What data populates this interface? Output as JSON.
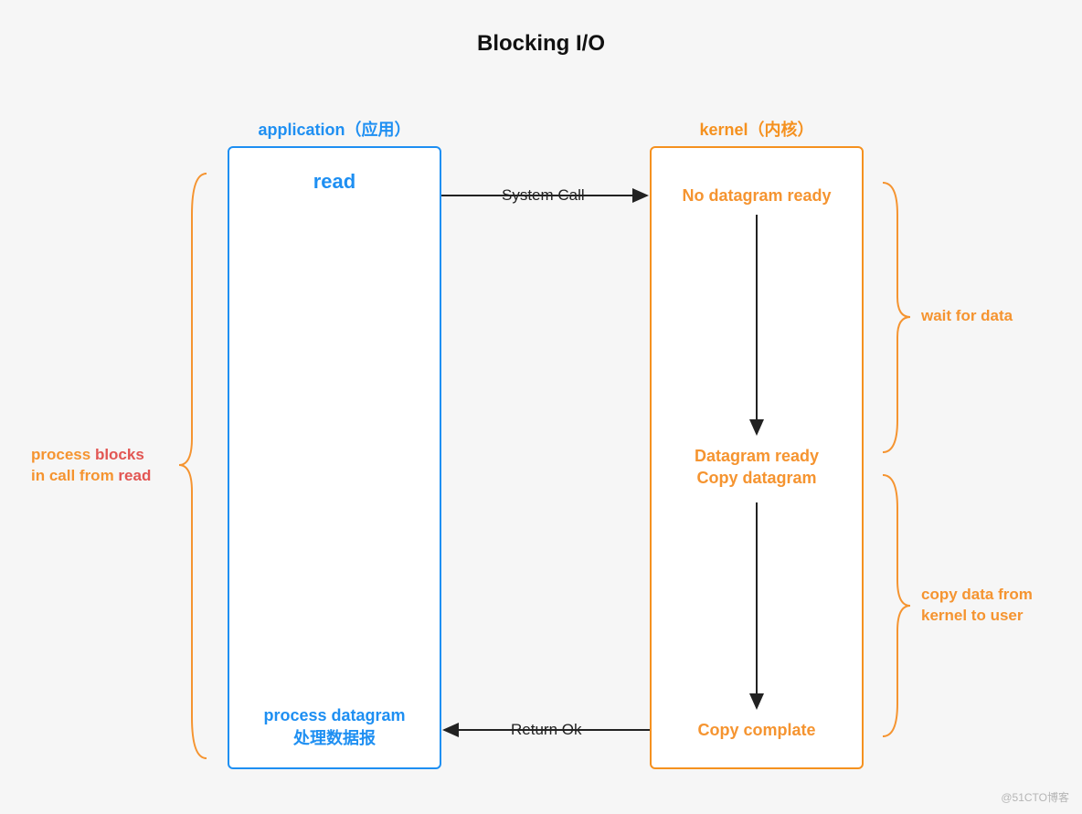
{
  "title": "Blocking I/O",
  "watermark": "@51CTO博客",
  "columns": {
    "application": {
      "header": "application（应用）",
      "top_label": "read",
      "bottom_label_1": "process datagram",
      "bottom_label_2": "处理数据报"
    },
    "kernel": {
      "header": "kernel（内核）",
      "state_1": "No datagram ready",
      "state_2a": "Datagram ready",
      "state_2b": "Copy datagram",
      "state_3": "Copy complate"
    }
  },
  "arrows": {
    "system_call": "System Call",
    "return_ok": "Return Ok"
  },
  "annotations": {
    "left_1": "process ",
    "left_1b": "blocks",
    "left_2": "in call from ",
    "left_2b": "read",
    "right_top": "wait for data",
    "right_bottom_1": "copy data from",
    "right_bottom_2": "kernel to user"
  },
  "colors": {
    "blue": "#1e8ff2",
    "orange": "#f5911f",
    "orange_text": "#f59430",
    "red": "#e25653"
  }
}
